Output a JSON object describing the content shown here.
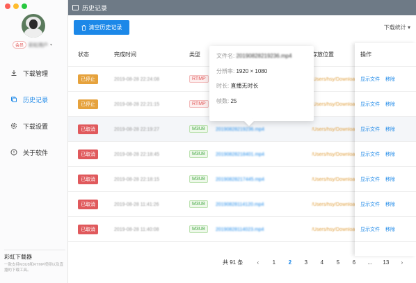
{
  "window": {
    "title": "历史记录",
    "colors": {
      "close": "#fd5f57",
      "minimize": "#febc2e",
      "maximize": "#28c840"
    }
  },
  "sidebar": {
    "user": {
      "badge": "会员",
      "name": "彩虹用户"
    },
    "items": [
      {
        "label": "下载管理",
        "icon": "download-icon"
      },
      {
        "label": "历史记录",
        "icon": "history-icon"
      },
      {
        "label": "下载设置",
        "icon": "gear-icon"
      },
      {
        "label": "关于软件",
        "icon": "info-icon"
      }
    ],
    "brand": {
      "title": "彩虹下载器",
      "desc": "一款支持M3U8和RTMP视频以及直播的下载工具。"
    }
  },
  "toolbar": {
    "clear_label": "清空历史记录",
    "stats_label": "下载统计"
  },
  "table": {
    "headers": {
      "status": "状态",
      "time": "完成时间",
      "type": "类型",
      "location": "存放位置",
      "ops": "操作"
    },
    "rows": [
      {
        "status": "已停止",
        "time": "2019-08-28 22:24:08",
        "type": "RTMP",
        "file": "",
        "location": "/Users/hsy/Downloads",
        "op1": "显示文件",
        "op2": "移除"
      },
      {
        "status": "已停止",
        "time": "2019-08-28 22:21:15",
        "type": "RTMP",
        "file": "",
        "location": "/Users/hsy/Downloads",
        "op1": "显示文件",
        "op2": "移除"
      },
      {
        "status": "已取消",
        "time": "2019-08-28 22:19:27",
        "type": "M3U8",
        "file": "20190828219236.mp4",
        "location": "/Users/hsy/Downloads",
        "op1": "显示文件",
        "op2": "移除"
      },
      {
        "status": "已取消",
        "time": "2019-08-28 22:18:45",
        "type": "M3U8",
        "file": "20190828218401.mp4",
        "location": "/Users/hsy/Downloads",
        "op1": "显示文件",
        "op2": "移除"
      },
      {
        "status": "已取消",
        "time": "2019-08-28 22:18:15",
        "type": "M3U8",
        "file": "20190828217445.mp4",
        "location": "/Users/hsy/Downloads",
        "op1": "显示文件",
        "op2": "移除"
      },
      {
        "status": "已取消",
        "time": "2019-08-28 11:41:26",
        "type": "M3U8",
        "file": "20190828114120.mp4",
        "location": "/Users/hsy/Downloads",
        "op1": "显示文件",
        "op2": "移除"
      },
      {
        "status": "已取消",
        "time": "2019-08-28 11:40:08",
        "type": "M3U8",
        "file": "20190828114023.mp4",
        "location": "/Users/hsy/Downloads",
        "op1": "显示文件",
        "op2": "移除"
      }
    ]
  },
  "tooltip": {
    "filename_key": "文件名:",
    "filename_val": "20190828219236.mp4",
    "res_key": "分辨率:",
    "res_val": "1920 × 1080",
    "dur_key": "时长:",
    "dur_val": "直播无时长",
    "fps_key": "帧数:",
    "fps_val": "25"
  },
  "pagination": {
    "total": "共 91 条",
    "pages": [
      "1",
      "2",
      "3",
      "4",
      "5",
      "6",
      "...",
      "13"
    ],
    "active": "2",
    "prev": "‹",
    "next": "›"
  }
}
